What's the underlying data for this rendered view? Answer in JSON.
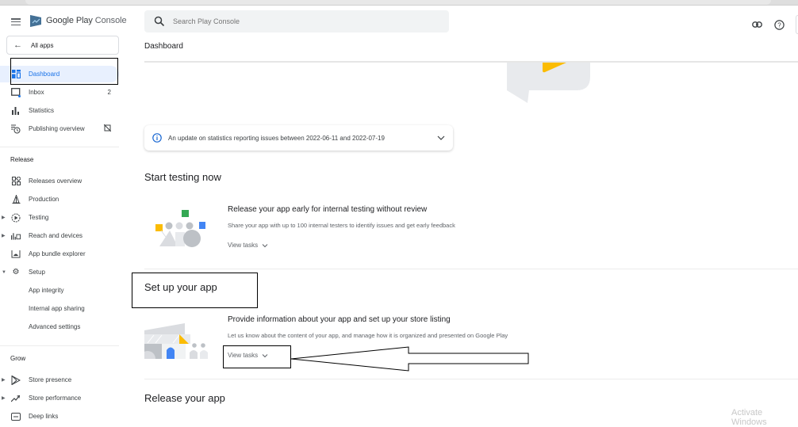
{
  "app": {
    "logo_google_play": "Google Play",
    "logo_console": "Console"
  },
  "sidebar": {
    "all_apps": "All apps",
    "items": [
      {
        "label": "Dashboard",
        "icon": "dashboard-icon",
        "active": true
      },
      {
        "label": "Inbox",
        "icon": "inbox-icon",
        "badge": "2"
      },
      {
        "label": "Statistics",
        "icon": "statistics-icon"
      },
      {
        "label": "Publishing overview",
        "icon": "publishing-overview-icon"
      }
    ],
    "release_section": "Release",
    "release_items": [
      {
        "label": "Releases overview",
        "icon": "releases-overview-icon"
      },
      {
        "label": "Production",
        "icon": "production-icon"
      },
      {
        "label": "Testing",
        "icon": "testing-icon",
        "expandable": true
      },
      {
        "label": "Reach and devices",
        "icon": "reach-devices-icon",
        "expandable": true
      },
      {
        "label": "App bundle explorer",
        "icon": "app-bundle-icon"
      },
      {
        "label": "Setup",
        "icon": "gear-icon",
        "expanded": true
      }
    ],
    "setup_subitems": [
      "App integrity",
      "Internal app sharing",
      "Advanced settings"
    ],
    "grow_section": "Grow",
    "grow_items": [
      {
        "label": "Store presence",
        "icon": "store-presence-icon",
        "expandable": true
      },
      {
        "label": "Store performance",
        "icon": "store-performance-icon",
        "expandable": true
      },
      {
        "label": "Deep links",
        "icon": "deep-links-icon"
      }
    ]
  },
  "header": {
    "search_placeholder": "Search Play Console",
    "page_title": "Dashboard"
  },
  "banner": {
    "text": "An update on statistics reporting issues between 2022-06-11 and 2022-07-19"
  },
  "sections": [
    {
      "title": "Start testing now",
      "card_title": "Release your app early for internal testing without review",
      "card_sub": "Share your app with up to 100 internal testers to identify issues and get early feedback",
      "action": "View tasks"
    },
    {
      "title": "Set up your app",
      "card_title": "Provide information about your app and set up your store listing",
      "card_sub": "Let us know about the content of your app, and manage how it is organized and presented on Google Play",
      "action": "View tasks"
    },
    {
      "title": "Release your app"
    }
  ],
  "colors": {
    "accent": "#1a73e8",
    "active_bg": "#e8f0fe",
    "yellow": "#fbbc04",
    "green": "#34a853",
    "blue": "#4285f4"
  },
  "watermark": "Activate Windows"
}
